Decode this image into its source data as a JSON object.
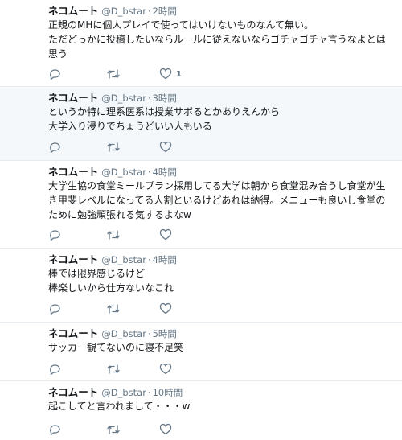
{
  "tweets": [
    {
      "name": "ネコムート",
      "handle": "@D_bstar",
      "separator": "·",
      "time": "2時間",
      "lines": [
        "正規のMHに個人プレイで使ってはいけないものなんて無い。",
        "ただどっかに投稿したいならルールに従えないならゴチャゴチャ言うなよとは",
        "思う"
      ],
      "like_count": "1",
      "highlighted": false
    },
    {
      "name": "ネコムート",
      "handle": "@D_bstar",
      "separator": "·",
      "time": "3時間",
      "lines": [
        "というか特に理系医系は授業サボるとかありえんから",
        "大学入り浸りでちょうどいい人もいる"
      ],
      "like_count": "",
      "highlighted": true
    },
    {
      "name": "ネコムート",
      "handle": "@D_bstar",
      "separator": "·",
      "time": "4時間",
      "lines": [
        "大学生協の食堂ミールプラン採用してる大学は朝から食堂混み合うし食堂が生",
        "き甲斐レベルになってる人割といるけどあれは納得。メニューも良いし食堂の",
        "ために勉強頑張れる気するよなw"
      ],
      "like_count": "",
      "highlighted": false
    },
    {
      "name": "ネコムート",
      "handle": "@D_bstar",
      "separator": "·",
      "time": "4時間",
      "lines": [
        "棒では限界感じるけど",
        "棒楽しいから仕方ないなこれ"
      ],
      "like_count": "",
      "highlighted": false
    },
    {
      "name": "ネコムート",
      "handle": "@D_bstar",
      "separator": "·",
      "time": "5時間",
      "lines": [
        "サッカー観てないのに寝不足笑"
      ],
      "like_count": "",
      "highlighted": false
    },
    {
      "name": "ネコムート",
      "handle": "@D_bstar",
      "separator": "·",
      "time": "10時間",
      "lines": [
        "起こしてと言われまして・・・w"
      ],
      "like_count": "",
      "highlighted": false
    }
  ],
  "icons": {
    "reply": "reply-icon",
    "retweet": "retweet-icon",
    "like": "heart-icon"
  },
  "colors": {
    "text": "#14171a",
    "secondary": "#657786",
    "highlight_bg": "#f5f8fa",
    "divider": "#e6ecf0"
  }
}
